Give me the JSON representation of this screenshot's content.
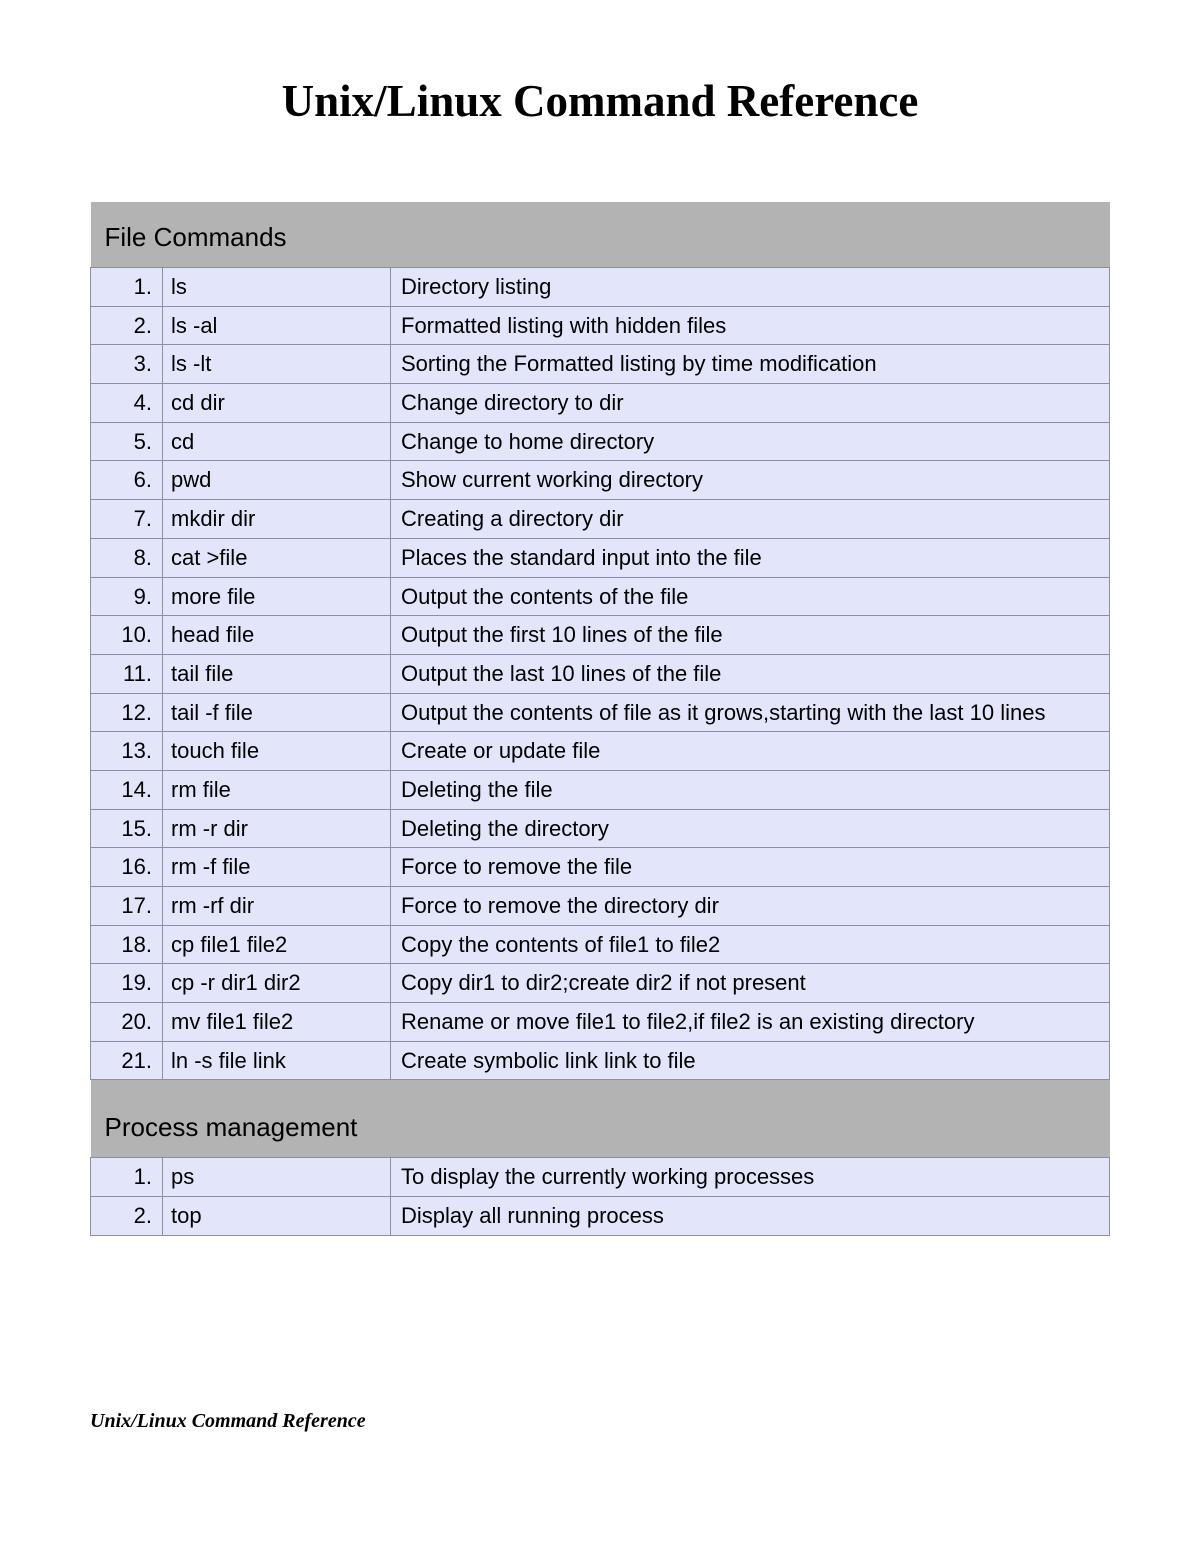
{
  "title": "Unix/Linux Command Reference",
  "footer": "Unix/Linux Command Reference",
  "sections": [
    {
      "heading": "File Commands",
      "rows": [
        {
          "n": "1.",
          "cmd": "ls",
          "desc": "Directory listing"
        },
        {
          "n": "2.",
          "cmd": "ls -al",
          "desc": "Formatted listing with hidden files"
        },
        {
          "n": "3.",
          "cmd": "ls  -lt",
          "desc": "Sorting the Formatted listing by time modification"
        },
        {
          "n": "4.",
          "cmd": "cd dir",
          "desc": "Change directory to dir"
        },
        {
          "n": "5.",
          "cmd": "cd",
          "desc": "Change to home directory"
        },
        {
          "n": "6.",
          "cmd": "pwd",
          "desc": "Show current working directory"
        },
        {
          "n": "7.",
          "cmd": "mkdir dir",
          "desc": "Creating a directory dir"
        },
        {
          "n": "8.",
          "cmd": "cat >file",
          "desc": "Places the standard input into the file"
        },
        {
          "n": "9.",
          "cmd": "more file",
          "desc": "Output the contents of the file"
        },
        {
          "n": "10.",
          "cmd": "head file",
          "desc": "Output the first 10 lines of the file"
        },
        {
          "n": "11.",
          "cmd": "tail file",
          "desc": "Output the last 10 lines of the file"
        },
        {
          "n": "12.",
          "cmd": "tail -f file",
          "desc": "Output the contents of file as it grows,starting with the last 10 lines"
        },
        {
          "n": "13.",
          "cmd": "touch file",
          "desc": "Create or update file"
        },
        {
          "n": "14.",
          "cmd": "rm file",
          "desc": "Deleting the file"
        },
        {
          "n": "15.",
          "cmd": "rm -r dir",
          "desc": "Deleting the directory"
        },
        {
          "n": "16.",
          "cmd": "rm -f file",
          "desc": "Force to remove the file"
        },
        {
          "n": "17.",
          "cmd": "rm -rf dir",
          "desc": "Force to remove the directory dir"
        },
        {
          "n": "18.",
          "cmd": "cp file1 file2",
          "desc": "Copy the contents of file1 to file2"
        },
        {
          "n": "19.",
          "cmd": "cp -r dir1 dir2",
          "desc": "Copy dir1 to dir2;create dir2 if not present"
        },
        {
          "n": "20.",
          "cmd": "mv file1 file2",
          "desc": "Rename or move file1 to file2,if file2 is an existing directory"
        },
        {
          "n": "21.",
          "cmd": "ln -s file link",
          "desc": "Create symbolic link link to file"
        }
      ]
    },
    {
      "heading": "Process management",
      "rows": [
        {
          "n": "1.",
          "cmd": "ps",
          "desc": "To display the currently working processes"
        },
        {
          "n": "2.",
          "cmd": "top",
          "desc": "Display all running process"
        }
      ]
    }
  ]
}
